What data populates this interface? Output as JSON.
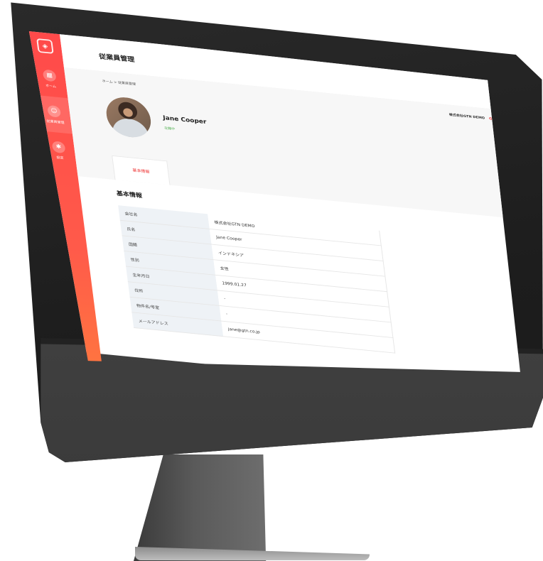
{
  "sidebar": {
    "items": [
      {
        "label": "ホーム",
        "icon": "grid-icon"
      },
      {
        "label": "従業員管理",
        "icon": "people-icon"
      },
      {
        "label": "設定",
        "icon": "gear-icon"
      }
    ]
  },
  "header": {
    "title": "従業員管理",
    "breadcrumb": "ホーム > 従業員管理",
    "company": "株式会社GTN DEMO",
    "company_code": "GTN"
  },
  "profile": {
    "name": "Jane Cooper",
    "status": "在籍中"
  },
  "tabs": [
    {
      "label": "基本情報",
      "active": true
    }
  ],
  "section": {
    "title": "基本情報",
    "rows": [
      {
        "label": "会社名",
        "value": "株式会社GTN DEMO"
      },
      {
        "label": "氏名",
        "value": "Jane Cooper"
      },
      {
        "label": "国籍",
        "value": "インドネシア"
      },
      {
        "label": "性別",
        "value": "女性"
      },
      {
        "label": "生年月日",
        "value": "1999.01.27"
      },
      {
        "label": "住所",
        "value": "-"
      },
      {
        "label": "物件名/号室",
        "value": "-"
      },
      {
        "label": "メールアドレス",
        "value": "jane@gtn.co.jp"
      }
    ]
  },
  "colors": {
    "accent": "#ff4a4a",
    "accent_gradient_end": "#ff7a3e",
    "status_green": "#5ab45a"
  }
}
